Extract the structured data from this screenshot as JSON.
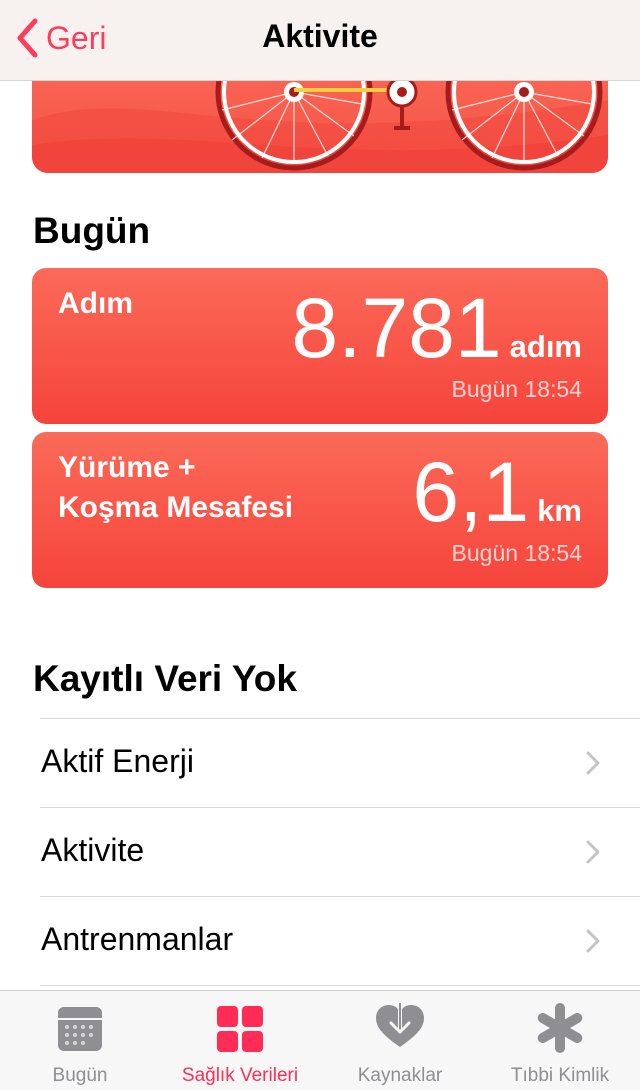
{
  "nav": {
    "back_label": "Geri",
    "title": "Aktivite"
  },
  "today_section": {
    "title": "Bugün",
    "cards": [
      {
        "label": "Adım",
        "value": "8.781",
        "unit": "adım",
        "time": "Bugün 18:54"
      },
      {
        "label": "Yürüme +\nKoşma Mesafesi",
        "value": "6,1",
        "unit": "km",
        "time": "Bugün 18:54"
      }
    ]
  },
  "no_data_section": {
    "title": "Kayıtlı Veri Yok",
    "items": [
      {
        "label": "Aktif Enerji"
      },
      {
        "label": "Aktivite"
      },
      {
        "label": "Antrenmanlar"
      }
    ]
  },
  "tabbar": {
    "tabs": [
      {
        "label": "Bugün",
        "icon": "calendar-icon",
        "active": false
      },
      {
        "label": "Sağlık Verileri",
        "icon": "grid-icon",
        "active": true
      },
      {
        "label": "Kaynaklar",
        "icon": "heart-download-icon",
        "active": false
      },
      {
        "label": "Tıbbi Kimlik",
        "icon": "asterisk-icon",
        "active": false
      }
    ]
  },
  "colors": {
    "accent": "#ff2d55",
    "card": "#f7574a",
    "inactive": "#8e8e93"
  }
}
